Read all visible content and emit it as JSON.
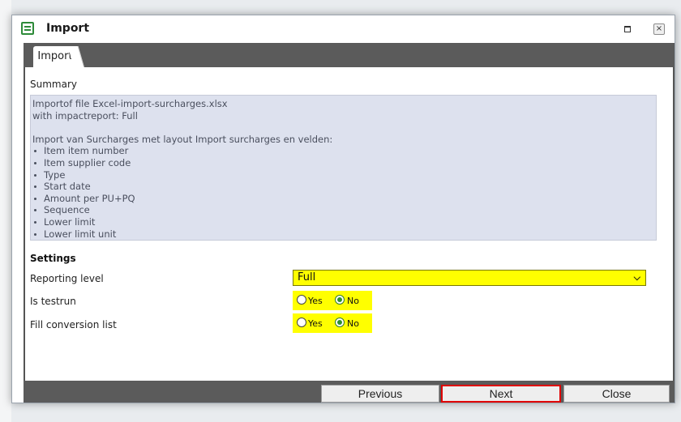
{
  "window": {
    "title": "Import"
  },
  "tabs": [
    {
      "label": "Import"
    }
  ],
  "summary": {
    "label": "Summary",
    "lines": [
      "Importof file Excel-import-surcharges.xlsx",
      "with impactreport: Full",
      "",
      "Import van Surcharges met layout Import surcharges en velden:"
    ],
    "fields": [
      "Item item number",
      "Item supplier code",
      "Type",
      "Start date",
      "Amount per PU+PQ",
      "Sequence",
      "Lower limit",
      "Lower limit unit"
    ]
  },
  "settings": {
    "heading": "Settings",
    "reporting_level": {
      "label": "Reporting level",
      "value": "Full"
    },
    "is_testrun": {
      "label": "Is testrun",
      "yes": "Yes",
      "no": "No",
      "selected": "No"
    },
    "fill_conversion": {
      "label": "Fill conversion list",
      "yes": "Yes",
      "no": "No",
      "selected": "No"
    }
  },
  "footer": {
    "previous": "Previous",
    "next": "Next",
    "close": "Close"
  },
  "colors": {
    "highlight": "#ffff00",
    "frame": "#5b5b5b",
    "summary_bg": "#dde1ee",
    "next_border": "#e00000"
  }
}
